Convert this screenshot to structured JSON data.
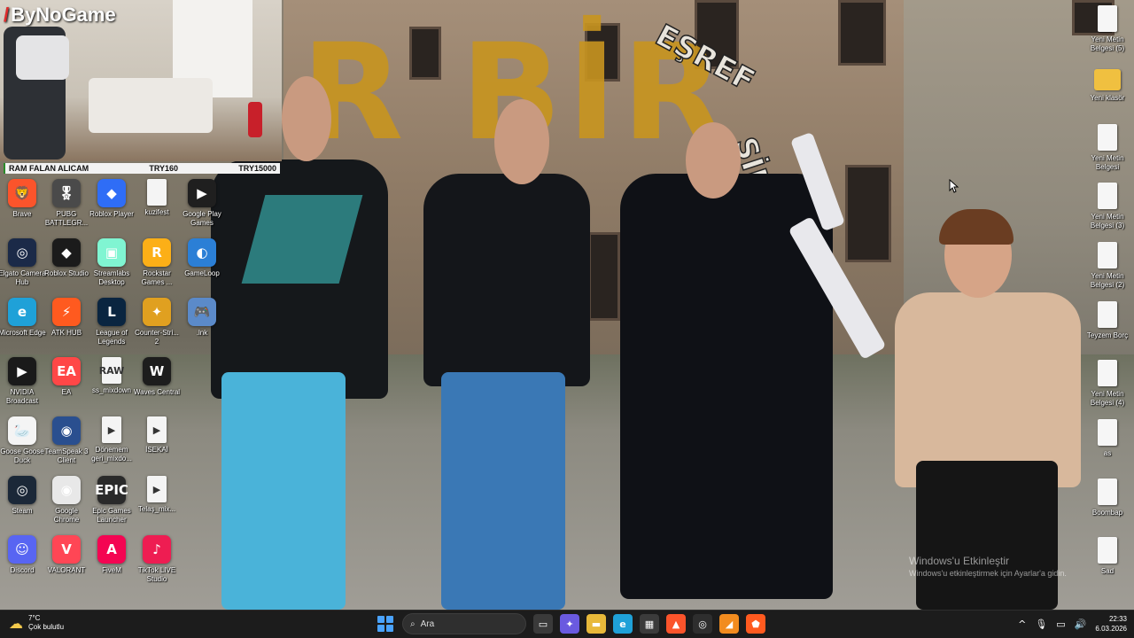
{
  "webcam": {
    "logo": "ByNoGame",
    "ticker": {
      "left": "RAM FALAN ALICAM",
      "mid": "TRY160",
      "right": "TRY15000"
    }
  },
  "wallpaper": {
    "big_text": "R BİR",
    "curve_text_1": "EŞREF",
    "curve_text_2": "SİK"
  },
  "desktop_left": [
    {
      "label": "Brave",
      "icon": "brave-icon",
      "color": "#fb542b",
      "glyph": "🦁"
    },
    {
      "label": "PUBG BATTLEGR...",
      "icon": "pubg-icon",
      "color": "#4a4a4a",
      "glyph": "🎖"
    },
    {
      "label": "Roblox Player",
      "icon": "roblox-player-icon",
      "color": "#2f6df6",
      "glyph": "◆"
    },
    {
      "label": "kuzifest",
      "icon": "document-icon",
      "color": "#f4f4f4",
      "glyph": ""
    },
    {
      "label": "Google Play Games",
      "icon": "google-play-games-icon",
      "color": "#1f1f1f",
      "glyph": "▶"
    },
    {
      "label": "Elgato Camera Hub",
      "icon": "elgato-icon",
      "color": "#1b2a48",
      "glyph": "◎"
    },
    {
      "label": "Roblox Studio",
      "icon": "roblox-studio-icon",
      "color": "#1b1b1b",
      "glyph": "◆"
    },
    {
      "label": "Streamlabs Desktop",
      "icon": "streamlabs-icon",
      "color": "#80f5d2",
      "glyph": "▣"
    },
    {
      "label": "Rockstar Games ...",
      "icon": "rockstar-icon",
      "color": "#fcaf17",
      "glyph": "R"
    },
    {
      "label": "GameLoop",
      "icon": "gameloop-icon",
      "color": "#2b7fd6",
      "glyph": "◐"
    },
    {
      "label": "Microsoft Edge",
      "icon": "edge-icon",
      "color": "#1fa1d8",
      "glyph": "e"
    },
    {
      "label": "ATK HUB",
      "icon": "atk-hub-icon",
      "color": "#ff5a1f",
      "glyph": "⚡"
    },
    {
      "label": "League of Legends",
      "icon": "league-icon",
      "color": "#0a2540",
      "glyph": "L"
    },
    {
      "label": "Counter-Stri... 2",
      "icon": "counter-strike-icon",
      "color": "#e0a020",
      "glyph": "✦"
    },
    {
      "label": ".lnk",
      "icon": "shortcut-icon",
      "color": "#5b8ac9",
      "glyph": "🎮"
    },
    {
      "label": "NVIDIA Broadcast",
      "icon": "nvidia-icon",
      "color": "#1a1a1a",
      "glyph": "▶"
    },
    {
      "label": "EA",
      "icon": "ea-icon",
      "color": "#ff4747",
      "glyph": "EA"
    },
    {
      "label": "ss_mixdown",
      "icon": "raw-file-icon",
      "color": "#f4f4f4",
      "glyph": "RAW"
    },
    {
      "label": "Waves Central",
      "icon": "waves-icon",
      "color": "#1d1d1d",
      "glyph": "W"
    },
    {
      "label": "",
      "icon": "",
      "color": "",
      "glyph": ""
    },
    {
      "label": "Goose Goose Duck",
      "icon": "goose-icon",
      "color": "#f4f4f4",
      "glyph": "🦢"
    },
    {
      "label": "TeamSpeak 3 Client",
      "icon": "teamspeak-icon",
      "color": "#2a4f8f",
      "glyph": "◉"
    },
    {
      "label": "Dönemem geri_mixdo...",
      "icon": "video-file-icon",
      "color": "#f4f4f4",
      "glyph": "▶"
    },
    {
      "label": "İSEKAİ",
      "icon": "video-file-icon",
      "color": "#f4f4f4",
      "glyph": "▶"
    },
    {
      "label": "",
      "icon": "",
      "color": "",
      "glyph": ""
    },
    {
      "label": "Steam",
      "icon": "steam-icon",
      "color": "#1b2838",
      "glyph": "◎"
    },
    {
      "label": "Google Chrome",
      "icon": "chrome-icon",
      "color": "#e8e8e8",
      "glyph": "◉"
    },
    {
      "label": "Epic Games Launcher",
      "icon": "epic-games-icon",
      "color": "#2a2a2a",
      "glyph": "EPIC"
    },
    {
      "label": "Telaş_mix...",
      "icon": "video-file-icon",
      "color": "#f4f4f4",
      "glyph": "▶"
    },
    {
      "label": "",
      "icon": "",
      "color": "",
      "glyph": ""
    },
    {
      "label": "Discord",
      "icon": "discord-icon",
      "color": "#5865f2",
      "glyph": "☺"
    },
    {
      "label": "VALORANT",
      "icon": "valorant-icon",
      "color": "#ff4655",
      "glyph": "V"
    },
    {
      "label": "FiveM",
      "icon": "fivem-icon",
      "color": "#f40552",
      "glyph": "A"
    },
    {
      "label": "TikTok LIVE Studio",
      "icon": "tiktok-icon",
      "color": "#ee1d52",
      "glyph": "♪"
    }
  ],
  "desktop_right": [
    {
      "label": "Yeni Metin Belgesi (5)",
      "icon": "document-icon"
    },
    {
      "label": "Yeni klasör",
      "icon": "folder-icon"
    },
    {
      "label": "Yeni Metin Belgesi",
      "icon": "document-icon"
    },
    {
      "label": "Yeni Metin Belgesi (3)",
      "icon": "document-icon"
    },
    {
      "label": "Yeni Metin Belgesi (2)",
      "icon": "document-icon"
    },
    {
      "label": "Teyzem Borç",
      "icon": "document-icon"
    },
    {
      "label": "Yeni Metin Belgesi (4)",
      "icon": "document-icon"
    },
    {
      "label": "as",
      "icon": "document-icon"
    },
    {
      "label": "Boombap",
      "icon": "document-icon"
    },
    {
      "label": "Sad",
      "icon": "document-icon"
    }
  ],
  "watermark": {
    "line1": "Windows'u Etkinleştir",
    "line2": "Windows'u etkinleştirmek için Ayarlar'a gidin."
  },
  "taskbar": {
    "weather_temp": "7°C",
    "weather_desc": "Çok bulutlu",
    "search_placeholder": "Ara",
    "apps": [
      {
        "name": "file-explorer-icon",
        "color": "#3a3a3a",
        "glyph": "▭"
      },
      {
        "name": "copilot-icon",
        "color": "#6a5ae0",
        "glyph": "✦"
      },
      {
        "name": "folder-icon",
        "color": "#e8b93a",
        "glyph": "▬"
      },
      {
        "name": "edge-icon",
        "color": "#1fa1d8",
        "glyph": "e"
      },
      {
        "name": "store-icon",
        "color": "#3b3b3b",
        "glyph": "▦"
      },
      {
        "name": "brave-icon",
        "color": "#fb542b",
        "glyph": "▲"
      },
      {
        "name": "obs-icon",
        "color": "#2e2e2e",
        "glyph": "◎"
      },
      {
        "name": "fl-studio-icon",
        "color": "#f28c1f",
        "glyph": "◢"
      },
      {
        "name": "shield-app-icon",
        "color": "#ff5a1f",
        "glyph": "⬟"
      }
    ],
    "time": "22:33",
    "date": "6.03.2026"
  }
}
